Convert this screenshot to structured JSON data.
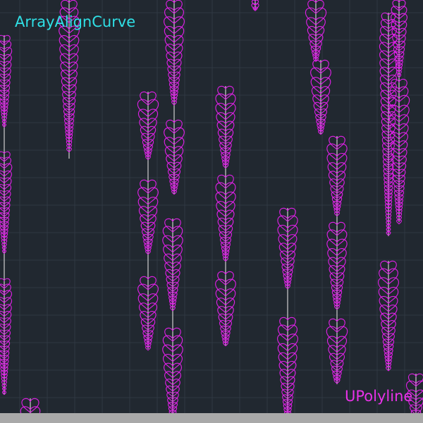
{
  "app": {
    "command_label": "ArrayAlignCurve",
    "object_label": "UPolyline"
  },
  "colors": {
    "background": "#212830",
    "grid": "#2f3842",
    "command_label": "#2fe0e6",
    "object_label": "#e832e8",
    "heart": "#e020e8",
    "path": "#cfcfcf",
    "status_bar": "#a9a9a9"
  },
  "canvas": {
    "icon": "heart-icon",
    "heart_columns": 19
  }
}
